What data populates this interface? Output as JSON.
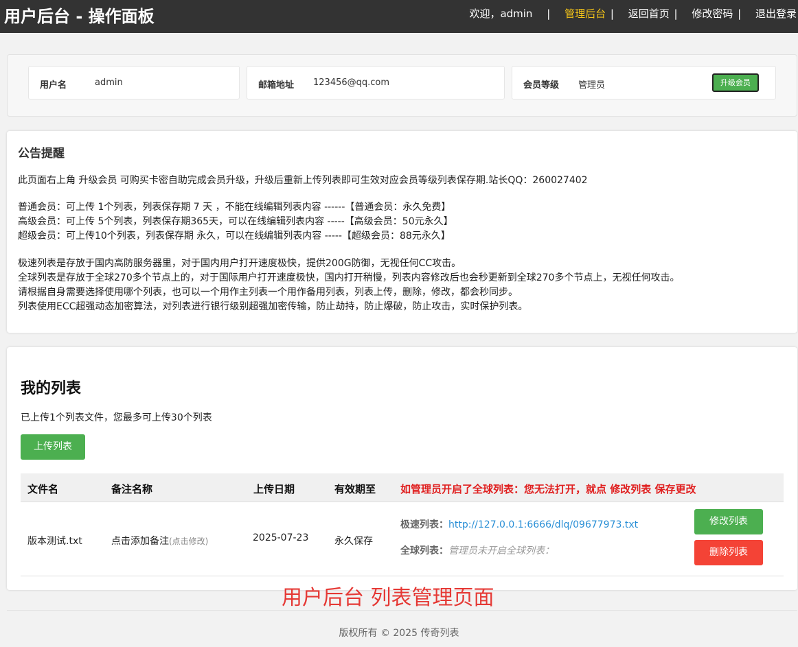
{
  "header": {
    "title": "用户后台 - 操作面板",
    "welcome": "欢迎，admin",
    "welcome_sep": "|",
    "nav": [
      {
        "label": "管理后台",
        "sep": "|"
      },
      {
        "label": "返回首页",
        "sep": "|"
      },
      {
        "label": "修改密码",
        "sep": "|"
      },
      {
        "label": "退出登录",
        "sep": ""
      }
    ]
  },
  "user_info": {
    "username_label": "用户名",
    "username": "admin",
    "email_label": "邮箱地址",
    "email": "123456@qq.com",
    "level_label": "会员等级",
    "level": "管理员",
    "upgrade_label": "升级会员"
  },
  "notice": {
    "title": "公告提醒",
    "intro": "此页面右上角 升级会员 可购买卡密自助完成会员升级，升级后重新上传列表即可生效对应会员等级列表保存期.站长QQ：260027402",
    "tiers": [
      "普通会员：可上传 1个列表，列表保存期 7 天 ，不能在线编辑列表内容 ------【普通会员：永久免费】",
      "高级会员：可上传 5个列表，列表保存期365天，可以在线编辑列表内容 -----【高级会员：50元永久】",
      "超级会员：可上传10个列表，列表保存期 永久，可以在线编辑列表内容 -----【超级会员：88元永久】"
    ],
    "details": [
      "极速列表是存放于国内高防服务器里，对于国内用户打开速度极快，提供200G防御，无视任何CC攻击。",
      "全球列表是存放于全球270多个节点上的，对于国际用户打开速度极快，国内打开稍慢，列表内容修改后也会秒更新到全球270多个节点上，无视任何攻击。",
      "请根据自身需要选择使用哪个列表，也可以一个用作主列表一个用作备用列表，列表上传，删除，修改，都会秒同步。",
      "列表使用ECC超强动态加密算法，对列表进行银行级别超强加密传输，防止劫持，防止爆破，防止攻击，实时保护列表。"
    ]
  },
  "my_list": {
    "title": "我的列表",
    "count_text": "已上传1个列表文件，您最多可上传30个列表",
    "upload_label": "上传列表",
    "columns": [
      "文件名",
      "备注名称",
      "上传日期",
      "有效期至"
    ],
    "warning": "如管理员开启了全球列表：您无法打开，就点 修改列表 保存更改",
    "rows": [
      {
        "filename": "版本测试.txt",
        "note": "点击添加备注",
        "note_hint": "(点击修改)",
        "date": "2025-07-23",
        "expiry": "永久保存",
        "fast_label": "极速列表：",
        "fast_url": "http://127.0.0.1:6666/dlq/09677973.txt",
        "global_label": "全球列表：",
        "global_text": "管理员未开启全球列表：",
        "edit_label": "修改列表",
        "delete_label": "删除列表"
      }
    ]
  },
  "caption": "用户后台 列表管理页面",
  "footer": "版权所有 © 2025 传奇列表",
  "colors": {
    "topbar": "#333333",
    "active_nav": "#f5c518",
    "green": "#4caf50",
    "red": "#f44336",
    "warning_text": "#e02020",
    "link": "#2a8fd6"
  }
}
